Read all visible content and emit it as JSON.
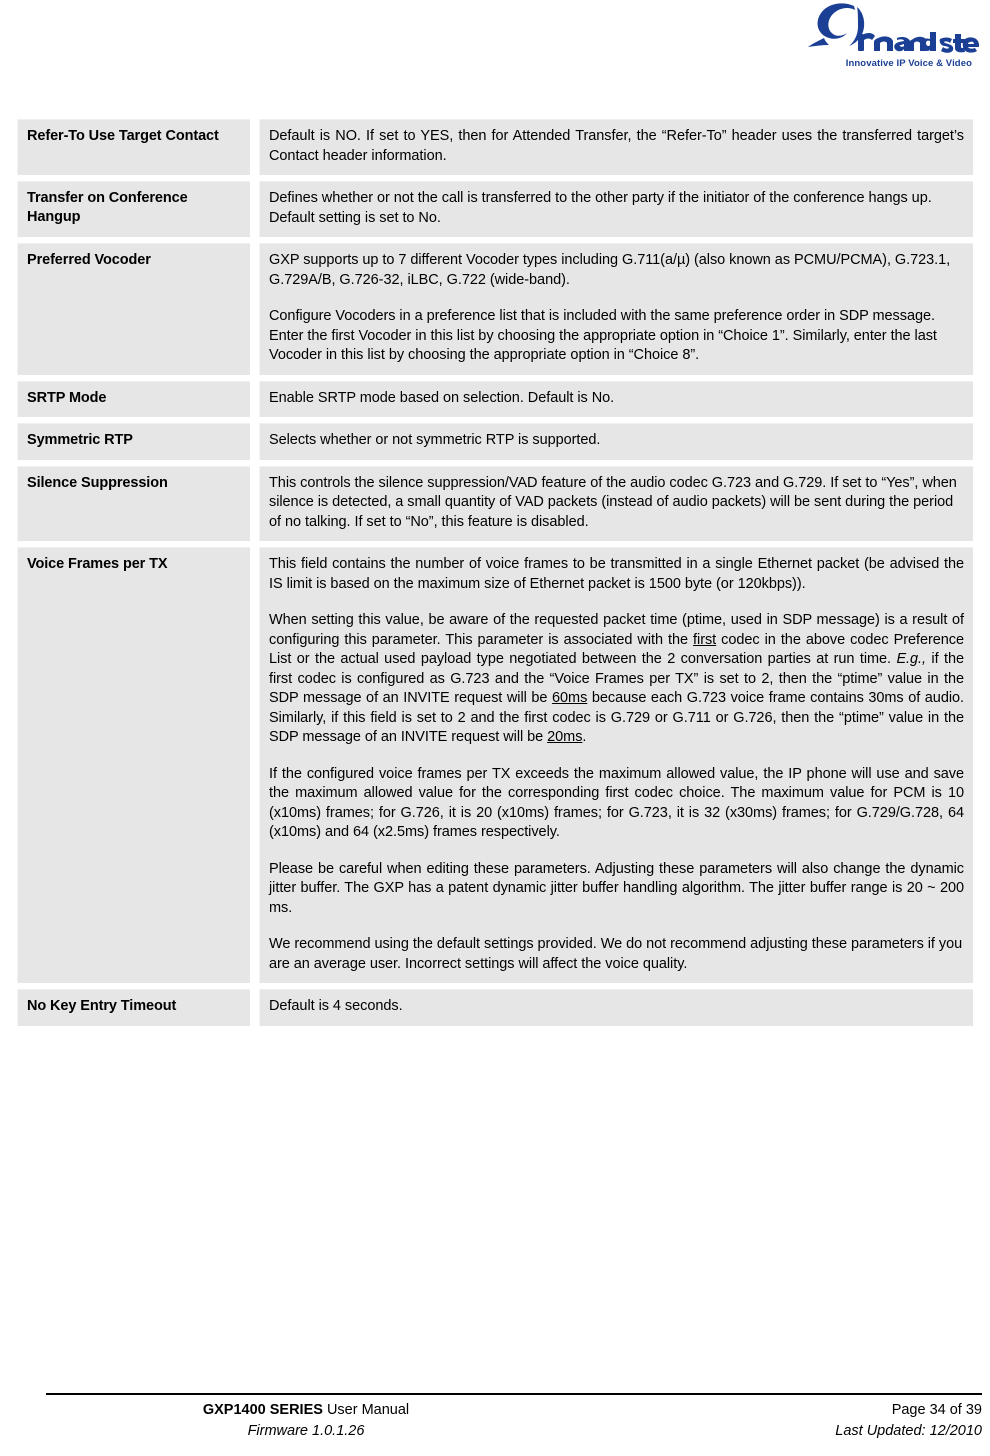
{
  "header": {
    "logo_name": "Grandstream",
    "logo_tagline": "Innovative IP Voice & Video",
    "brand_color": "#1b3f94"
  },
  "table": {
    "rows": [
      {
        "label": "Refer-To Use Target Contact",
        "paragraphs": [
          {
            "align": "justify",
            "runs": [
              {
                "text": "Default is NO. If set to YES, then for Attended Transfer, the “Refer-To” header uses the transferred target’s Contact header information."
              }
            ]
          }
        ]
      },
      {
        "label": "Transfer on Conference Hangup",
        "paragraphs": [
          {
            "align": "justify",
            "runs": [
              {
                "text": "Defines whether or not the call is transferred to the other party if the initiator of the conference hangs up."
              }
            ]
          },
          {
            "align": "left",
            "tight": true,
            "runs": [
              {
                "text": "Default setting is set to No."
              }
            ]
          }
        ]
      },
      {
        "label": "Preferred Vocoder",
        "paragraphs": [
          {
            "align": "left",
            "runs": [
              {
                "text": "GXP supports up to 7 different Vocoder types including G.711(a/µ) (also known as PCMU/PCMA), G.723.1, G.729A/B, G.726-32, iLBC, G.722 (wide-band)."
              }
            ]
          },
          {
            "align": "left",
            "runs": [
              {
                "text": "Configure Vocoders in a preference list that is included with the same preference order in SDP message. Enter the first Vocoder in this list by choosing the appropriate option in “Choice 1”. Similarly, enter the last Vocoder in this list by choosing the appropriate option in “Choice 8”."
              }
            ]
          }
        ]
      },
      {
        "label": "SRTP Mode",
        "paragraphs": [
          {
            "align": "left",
            "runs": [
              {
                "text": "Enable SRTP mode based on selection. Default is No."
              }
            ]
          }
        ]
      },
      {
        "label": "Symmetric RTP",
        "paragraphs": [
          {
            "align": "left",
            "runs": [
              {
                "text": "Selects whether or not symmetric RTP is supported."
              }
            ]
          }
        ]
      },
      {
        "label": "Silence Suppression",
        "paragraphs": [
          {
            "align": "left",
            "runs": [
              {
                "text": "This controls the silence suppression/VAD feature of the audio codec G.723 and G.729. If set to “Yes”, when silence is detected, a small quantity of VAD packets (instead of audio packets) will be sent during the period of no talking.  If set to “No”, this feature is disabled."
              }
            ]
          }
        ]
      },
      {
        "label": "Voice Frames per TX",
        "paragraphs": [
          {
            "align": "justify",
            "runs": [
              {
                "text": "This field contains the number of voice frames to be transmitted in a single Ethernet packet (be advised the IS limit is based on the maximum size of Ethernet packet is 1500 byte (or 120kbps))."
              }
            ]
          },
          {
            "align": "justify",
            "runs": [
              {
                "text": "When setting this value, be aware of the requested packet time (ptime, used in SDP message) is a result of configuring this parameter. This parameter is associated with the "
              },
              {
                "text": "first",
                "style": "underline"
              },
              {
                "text": " codec in the above codec Preference List or the actual used payload type negotiated between the 2 conversation parties at run time. "
              },
              {
                "text": "E.g.,",
                "style": "italic"
              },
              {
                "text": " if the first codec is configured as G.723 and the “Voice Frames per TX” is set to 2, then the “ptime” value in the SDP message of an INVITE request will be "
              },
              {
                "text": "60ms",
                "style": "underline"
              },
              {
                "text": " because each G.723 voice frame contains 30ms of audio. Similarly, if this field is set to 2 and the first codec is G.729 or G.711 or G.726, then the “ptime” value in the SDP message of an INVITE request will be "
              },
              {
                "text": "20ms",
                "style": "underline"
              },
              {
                "text": "."
              }
            ]
          },
          {
            "align": "justify",
            "runs": [
              {
                "text": "If the configured voice frames per TX exceeds the maximum allowed value, the IP phone will use and save the maximum allowed value for the corresponding first codec choice. The maximum value for PCM is 10 (x10ms) frames; for G.726, it is 20 (x10ms) frames; for G.723, it is 32 (x30ms) frames; for G.729/G.728, 64 (x10ms) and 64 (x2.5ms) frames respectively."
              }
            ]
          },
          {
            "align": "justify",
            "runs": [
              {
                "text": "Please be careful when editing these parameters. Adjusting these parameters will also change the dynamic jitter buffer.  The GXP has a patent dynamic jitter buffer handling algorithm. The jitter buffer range is 20 ~ 200 ms."
              }
            ]
          },
          {
            "align": "left",
            "runs": [
              {
                "text": "We recommend using the default settings provided. We do not recommend adjusting these parameters if you are an average user.  Incorrect settings will affect the voice quality."
              }
            ]
          }
        ]
      },
      {
        "label": "No Key Entry Timeout",
        "paragraphs": [
          {
            "align": "left",
            "runs": [
              {
                "text": "Default is 4 seconds."
              }
            ]
          }
        ]
      }
    ]
  },
  "footer": {
    "manual_bold": "GXP1400 SERIES",
    "manual_rest": " User Manual",
    "firmware": "Firmware 1.0.1.26",
    "page": "Page 34 of 39",
    "last_updated": "Last Updated:  12/2010"
  }
}
